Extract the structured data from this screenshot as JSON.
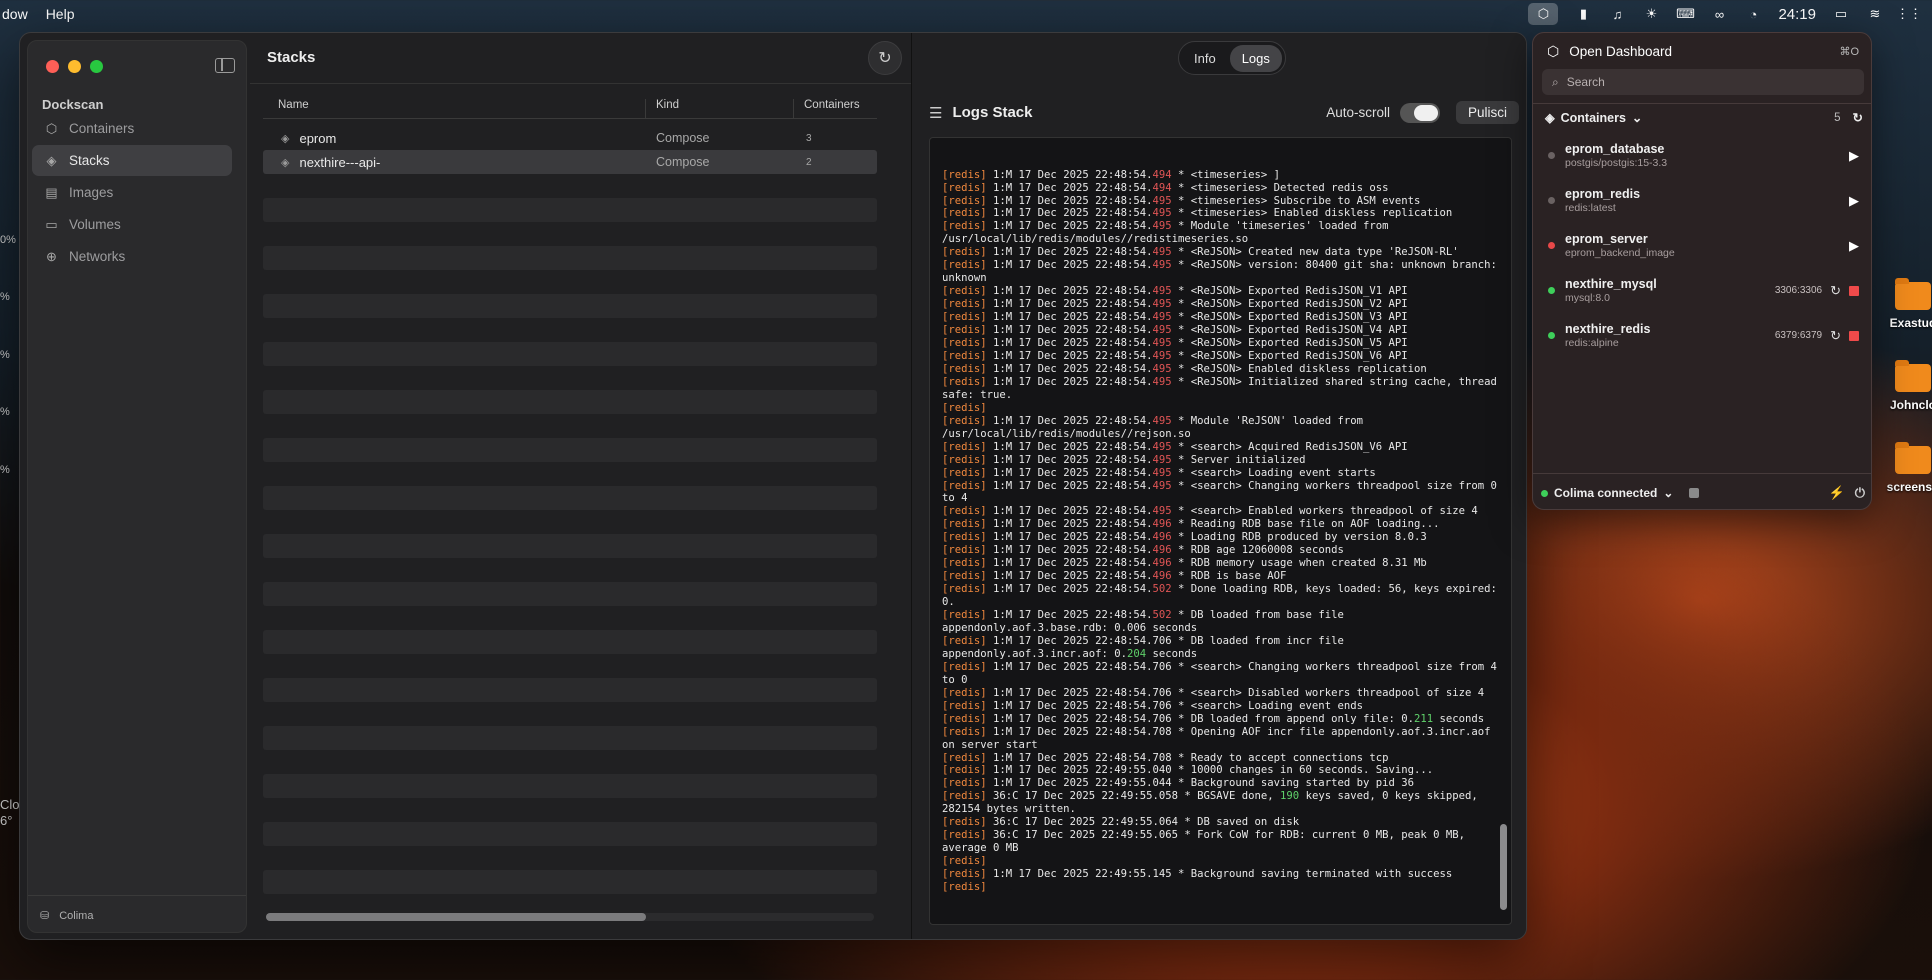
{
  "menubar": {
    "left_items": [
      "dow",
      "Help"
    ],
    "clock": "24:19"
  },
  "sidebar": {
    "section": "Dockscan",
    "items": [
      {
        "label": "Containers",
        "icon": "cube-icon"
      },
      {
        "label": "Stacks",
        "icon": "layers-icon"
      },
      {
        "label": "Images",
        "icon": "images-icon"
      },
      {
        "label": "Volumes",
        "icon": "drive-icon"
      },
      {
        "label": "Networks",
        "icon": "globe-icon"
      }
    ],
    "footer": "Colima"
  },
  "stacks": {
    "title": "Stacks",
    "columns": [
      "Name",
      "Kind",
      "Containers"
    ],
    "rows": [
      {
        "name": "eprom",
        "kind": "Compose",
        "containers": "3"
      },
      {
        "name": "nexthire---api-",
        "kind": "Compose",
        "containers": "2"
      }
    ]
  },
  "tabs": {
    "info": "Info",
    "logs": "Logs"
  },
  "logs": {
    "title": "Logs Stack",
    "autoscroll_label": "Auto-scroll",
    "clear_label": "Pulisci",
    "lines": [
      [
        "[redis]",
        " 1:M 17 Dec 2025 22:48:54.",
        "494",
        " * <timeseries> ]"
      ],
      [
        "[redis]",
        " 1:M 17 Dec 2025 22:48:54.",
        "494",
        " * <timeseries> Detected redis oss"
      ],
      [
        "[redis]",
        " 1:M 17 Dec 2025 22:48:54.",
        "495",
        " * <timeseries> Subscribe to ASM events"
      ],
      [
        "[redis]",
        " 1:M 17 Dec 2025 22:48:54.",
        "495",
        " * <timeseries> Enabled diskless replication"
      ],
      [
        "[redis]",
        " 1:M 17 Dec 2025 22:48:54.",
        "495",
        " * Module 'timeseries' loaded from /usr/local/lib/redis/modules//redistimeseries.so"
      ],
      [
        "[redis]",
        " 1:M 17 Dec 2025 22:48:54.",
        "495",
        " * <ReJSON> Created new data type 'ReJSON-RL'"
      ],
      [
        "[redis]",
        " 1:M 17 Dec 2025 22:48:54.",
        "495",
        " * <ReJSON> version: 80400 git sha: unknown branch: unknown"
      ],
      [
        "[redis]",
        " 1:M 17 Dec 2025 22:48:54.",
        "495",
        " * <ReJSON> Exported RedisJSON_V1 API"
      ],
      [
        "[redis]",
        " 1:M 17 Dec 2025 22:48:54.",
        "495",
        " * <ReJSON> Exported RedisJSON_V2 API"
      ],
      [
        "[redis]",
        " 1:M 17 Dec 2025 22:48:54.",
        "495",
        " * <ReJSON> Exported RedisJSON_V3 API"
      ],
      [
        "[redis]",
        " 1:M 17 Dec 2025 22:48:54.",
        "495",
        " * <ReJSON> Exported RedisJSON_V4 API"
      ],
      [
        "[redis]",
        " 1:M 17 Dec 2025 22:48:54.",
        "495",
        " * <ReJSON> Exported RedisJSON_V5 API"
      ],
      [
        "[redis]",
        " 1:M 17 Dec 2025 22:48:54.",
        "495",
        " * <ReJSON> Exported RedisJSON_V6 API"
      ],
      [
        "[redis]",
        " 1:M 17 Dec 2025 22:48:54.",
        "495",
        " * <ReJSON> Enabled diskless replication"
      ],
      [
        "[redis]",
        " 1:M 17 Dec 2025 22:48:54.",
        "495",
        " * <ReJSON> Initialized shared string cache, thread safe: true."
      ],
      [
        "[redis]",
        "",
        "",
        ""
      ],
      [
        "[redis]",
        " 1:M 17 Dec 2025 22:48:54.",
        "495",
        " * Module 'ReJSON' loaded from /usr/local/lib/redis/modules//rejson.so"
      ],
      [
        "[redis]",
        " 1:M 17 Dec 2025 22:48:54.",
        "495",
        " * <search> Acquired RedisJSON_V6 API"
      ],
      [
        "[redis]",
        " 1:M 17 Dec 2025 22:48:54.",
        "495",
        " * Server initialized"
      ],
      [
        "[redis]",
        " 1:M 17 Dec 2025 22:48:54.",
        "495",
        " * <search> Loading event starts"
      ],
      [
        "[redis]",
        " 1:M 17 Dec 2025 22:48:54.",
        "495",
        " * <search> Changing workers threadpool size from 0 to 4"
      ],
      [
        "[redis]",
        " 1:M 17 Dec 2025 22:48:54.",
        "495",
        " * <search> Enabled workers threadpool of size 4"
      ],
      [
        "[redis]",
        " 1:M 17 Dec 2025 22:48:54.",
        "496",
        " * Reading RDB base file on AOF loading..."
      ],
      [
        "[redis]",
        " 1:M 17 Dec 2025 22:48:54.",
        "496",
        " * Loading RDB produced by version 8.0.3"
      ],
      [
        "[redis]",
        " 1:M 17 Dec 2025 22:48:54.",
        "496",
        " * RDB age 12060008 seconds"
      ],
      [
        "[redis]",
        " 1:M 17 Dec 2025 22:48:54.",
        "496",
        " * RDB memory usage when created 8.31 Mb"
      ],
      [
        "[redis]",
        " 1:M 17 Dec 2025 22:48:54.",
        "496",
        " * RDB is base AOF"
      ],
      [
        "[redis]",
        " 1:M 17 Dec 2025 22:48:54.",
        "502",
        " * Done loading RDB, keys loaded: 56, keys expired: 0."
      ],
      [
        "[redis]",
        " 1:M 17 Dec 2025 22:48:54.",
        "502",
        " * DB loaded from base file appendonly.aof.3.base.rdb: 0.006 seconds"
      ],
      [
        "[redis]",
        " 1:M 17 Dec 2025 22:48:54.706 * DB loaded from incr file appendonly.aof.3.incr.aof: 0.",
        "204",
        " seconds",
        "num"
      ],
      [
        "[redis]",
        " 1:M 17 Dec 2025 22:48:54.706 * <search> Changing workers threadpool size from 4 to 0",
        "",
        ""
      ],
      [
        "[redis]",
        " 1:M 17 Dec 2025 22:48:54.706 * <search> Disabled workers threadpool of size 4",
        "",
        ""
      ],
      [
        "[redis]",
        " 1:M 17 Dec 2025 22:48:54.706 * <search> Loading event ends",
        "",
        ""
      ],
      [
        "[redis]",
        " 1:M 17 Dec 2025 22:48:54.706 * DB loaded from append only file: 0.",
        "211",
        " seconds",
        "num"
      ],
      [
        "[redis]",
        " 1:M 17 Dec 2025 22:48:54.708 * Opening AOF incr file appendonly.aof.3.incr.aof on server start",
        "",
        ""
      ],
      [
        "[redis]",
        " 1:M 17 Dec 2025 22:48:54.708 * Ready to accept connections tcp",
        "",
        ""
      ],
      [
        "[redis]",
        " 1:M 17 Dec 2025 22:49:55.040 * 10000 changes in 60 seconds. Saving...",
        "",
        ""
      ],
      [
        "[redis]",
        " 1:M 17 Dec 2025 22:49:55.044 * Background saving started by pid 36",
        "",
        ""
      ],
      [
        "[redis]",
        " 36:C 17 Dec 2025 22:49:55.058 * BGSAVE done, ",
        "190",
        " keys saved, 0 keys skipped, 282154 bytes written.",
        "num"
      ],
      [
        "[redis]",
        " 36:C 17 Dec 2025 22:49:55.064 * DB saved on disk",
        "",
        ""
      ],
      [
        "[redis]",
        " 36:C 17 Dec 2025 22:49:55.065 * Fork CoW for RDB: current 0 MB, peak 0 MB, average 0 MB",
        "",
        ""
      ],
      [
        "[redis]",
        "",
        "",
        ""
      ],
      [
        "[redis]",
        " 1:M 17 Dec 2025 22:49:55.145 * Background saving terminated with success",
        "",
        ""
      ],
      [
        "[redis]",
        "",
        "",
        ""
      ]
    ]
  },
  "popover": {
    "open_dashboard": "Open Dashboard",
    "shortcut": "⌘O",
    "search_placeholder": "Search",
    "containers_label": "Containers",
    "containers_count": "5",
    "containers": [
      {
        "name": "eprom_database",
        "image": "postgis/postgis:15-3.3",
        "status": "stopped",
        "ports": ""
      },
      {
        "name": "eprom_redis",
        "image": "redis:latest",
        "status": "stopped",
        "ports": ""
      },
      {
        "name": "eprom_server",
        "image": "eprom_backend_image",
        "status": "error",
        "ports": ""
      },
      {
        "name": "nexthire_mysql",
        "image": "mysql:8.0",
        "status": "running",
        "ports": "3306:3306"
      },
      {
        "name": "nexthire_redis",
        "image": "redis:alpine",
        "status": "running",
        "ports": "6379:6379"
      }
    ],
    "footer_label": "Colima connected"
  },
  "colors": {
    "running": "#3ecf5a",
    "stopped": "#6a6262",
    "error": "#e74848"
  },
  "desktop": {
    "folders": [
      "Exastud",
      "Johnclo",
      "screensh"
    ],
    "left_edge": [
      "0%",
      "%",
      "%",
      "%",
      "%",
      "Clo",
      "6°"
    ]
  }
}
